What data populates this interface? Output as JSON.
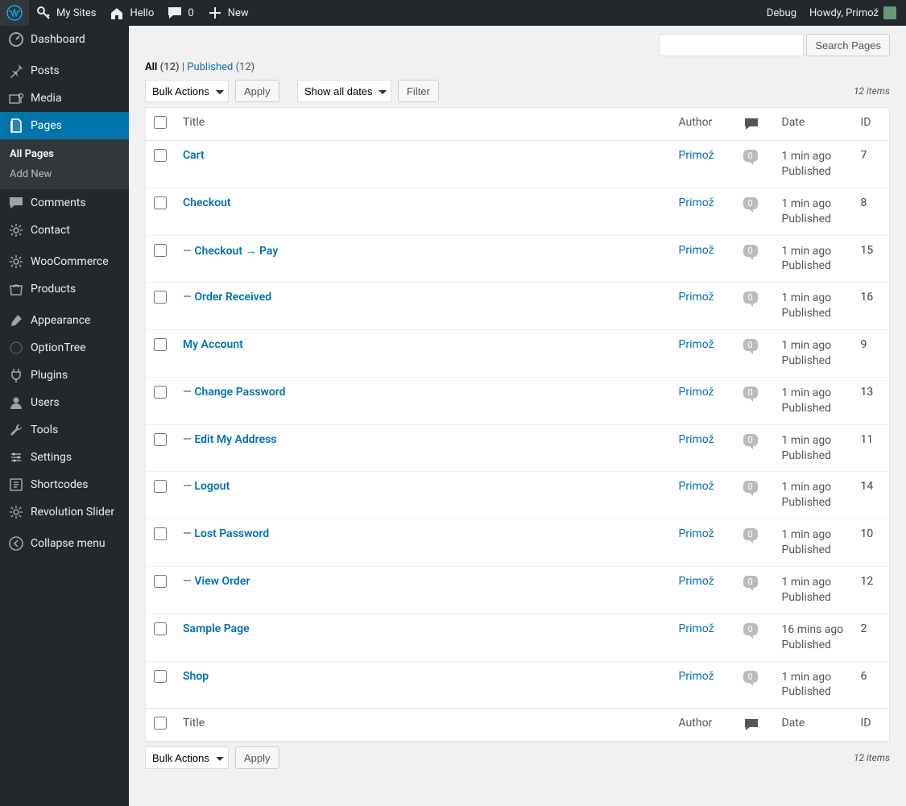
{
  "adminbar": {
    "my_sites": "My Sites",
    "site_name": "Hello",
    "comments_count": "0",
    "new": "New",
    "debug": "Debug",
    "howdy_prefix": "Howdy, ",
    "user": "Primož"
  },
  "sidebar": {
    "items": [
      {
        "label": "Dashboard",
        "icon": "dashboard"
      },
      {
        "label": "Posts",
        "icon": "pin"
      },
      {
        "label": "Media",
        "icon": "media"
      },
      {
        "label": "Pages",
        "icon": "pages",
        "current": true,
        "submenu": [
          {
            "label": "All Pages",
            "current": true
          },
          {
            "label": "Add New"
          }
        ]
      },
      {
        "label": "Comments",
        "icon": "comments"
      },
      {
        "label": "Contact",
        "icon": "gear"
      },
      {
        "label": "WooCommerce",
        "icon": "gear"
      },
      {
        "label": "Products",
        "icon": "products"
      },
      {
        "label": "Appearance",
        "icon": "brush"
      },
      {
        "label": "OptionTree",
        "icon": "optiontree"
      },
      {
        "label": "Plugins",
        "icon": "plug"
      },
      {
        "label": "Users",
        "icon": "users"
      },
      {
        "label": "Tools",
        "icon": "tools"
      },
      {
        "label": "Settings",
        "icon": "settings"
      },
      {
        "label": "Shortcodes",
        "icon": "shortcodes"
      },
      {
        "label": "Revolution Slider",
        "icon": "gear"
      }
    ],
    "collapse": "Collapse menu"
  },
  "filters": {
    "all_label": "All",
    "all_count": "(12)",
    "published_label": "Published",
    "published_count": "(12)",
    "separator": " | "
  },
  "search": {
    "button": "Search Pages",
    "value": ""
  },
  "bulk": {
    "label": "Bulk Actions",
    "apply": "Apply",
    "date_filter": "Show all dates",
    "filter": "Filter"
  },
  "count": {
    "num": "12",
    "word": " items"
  },
  "columns": {
    "title": "Title",
    "author": "Author",
    "date": "Date",
    "id": "ID"
  },
  "rows": [
    {
      "title": "Cart",
      "prefix": "",
      "author": "Primož",
      "comments": "0",
      "date1": "1 min ago",
      "date2": "Published",
      "id": "7"
    },
    {
      "title": "Checkout",
      "prefix": "",
      "author": "Primož",
      "comments": "0",
      "date1": "1 min ago",
      "date2": "Published",
      "id": "8"
    },
    {
      "title": "Checkout → Pay",
      "prefix": "— ",
      "author": "Primož",
      "comments": "0",
      "date1": "1 min ago",
      "date2": "Published",
      "id": "15"
    },
    {
      "title": "Order Received",
      "prefix": "— ",
      "author": "Primož",
      "comments": "0",
      "date1": "1 min ago",
      "date2": "Published",
      "id": "16"
    },
    {
      "title": "My Account",
      "prefix": "",
      "author": "Primož",
      "comments": "0",
      "date1": "1 min ago",
      "date2": "Published",
      "id": "9"
    },
    {
      "title": "Change Password",
      "prefix": "— ",
      "author": "Primož",
      "comments": "0",
      "date1": "1 min ago",
      "date2": "Published",
      "id": "13"
    },
    {
      "title": "Edit My Address",
      "prefix": "— ",
      "author": "Primož",
      "comments": "0",
      "date1": "1 min ago",
      "date2": "Published",
      "id": "11"
    },
    {
      "title": "Logout",
      "prefix": "— ",
      "author": "Primož",
      "comments": "0",
      "date1": "1 min ago",
      "date2": "Published",
      "id": "14"
    },
    {
      "title": "Lost Password",
      "prefix": "— ",
      "author": "Primož",
      "comments": "0",
      "date1": "1 min ago",
      "date2": "Published",
      "id": "10"
    },
    {
      "title": "View Order",
      "prefix": "— ",
      "author": "Primož",
      "comments": "0",
      "date1": "1 min ago",
      "date2": "Published",
      "id": "12"
    },
    {
      "title": "Sample Page",
      "prefix": "",
      "author": "Primož",
      "comments": "0",
      "date1": "16 mins ago",
      "date2": "Published",
      "id": "2"
    },
    {
      "title": "Shop",
      "prefix": "",
      "author": "Primož",
      "comments": "0",
      "date1": "1 min ago",
      "date2": "Published",
      "id": "6"
    }
  ]
}
